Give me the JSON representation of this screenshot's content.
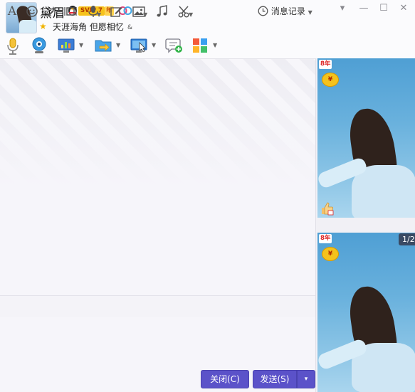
{
  "contact": {
    "nickname": "黛眉",
    "vip_badge": "SVIP 7",
    "vip_year": "年",
    "status_message": "天涯海角 但愿相忆",
    "status_suffix": "&"
  },
  "window_controls": {
    "dropdown": "▾",
    "minimize": "—",
    "maximize": "☐",
    "close": "✕"
  },
  "toolbar_icons": [
    "voice-call",
    "video-call",
    "screen-share",
    "file-transfer",
    "remote-assist",
    "create-group-chat",
    "apps"
  ],
  "input_toolbar_icons": [
    "font",
    "emoji",
    "magic",
    "screenshot-frame",
    "voice-message",
    "edit",
    "image",
    "music",
    "scissors"
  ],
  "history": {
    "label": "消息记录"
  },
  "buttons": {
    "close": "关闭(C)",
    "send": "发送(S)",
    "send_dropdown": "▾"
  },
  "right_panel": {
    "badge_year": "8年",
    "badge_coin": "¥",
    "page_counter": "1/2"
  },
  "colors": {
    "accent": "#5b52c9",
    "vip_gold": "#f6c21b",
    "sky_blue": "#69b1dd"
  }
}
